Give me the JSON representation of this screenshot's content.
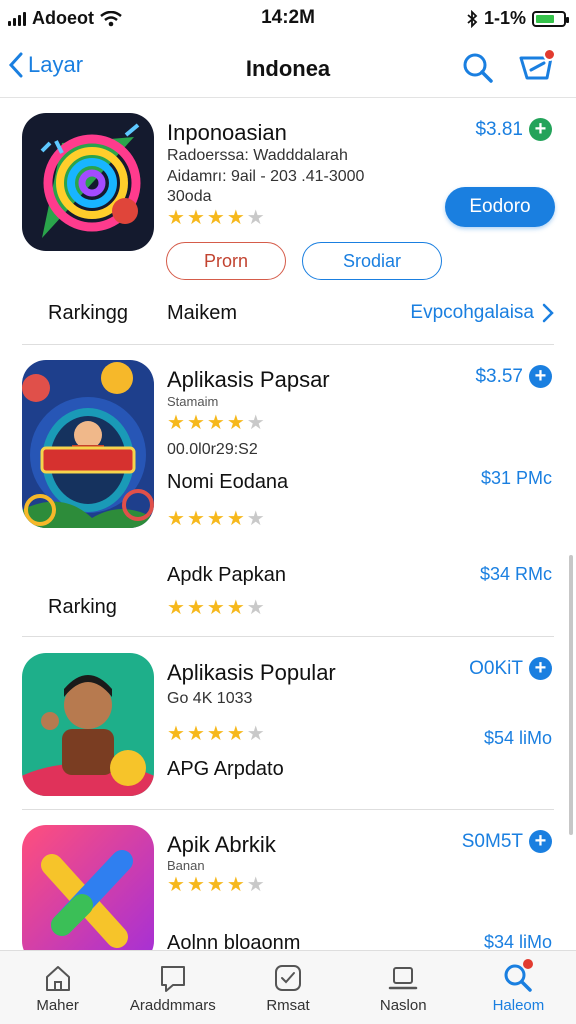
{
  "status_bar": {
    "carrier": "Adoeot",
    "time": "14:2M",
    "battery": "1-1%"
  },
  "nav": {
    "back_label": "Layar",
    "title": "Indonea"
  },
  "apps": [
    {
      "title": "Inponoasian",
      "meta1": "Radoerssa: Wadddalarah",
      "meta2": "Aidamrı: 9ail - 203 .41-3000",
      "meta3": "30oda",
      "price": "$3.81",
      "primary_button": "Eodoro",
      "button_a": "Prorn",
      "button_b": "Srodiar",
      "row_label": "Rarkingg",
      "row_mid": "Maikem",
      "row_link": "Evpcohgalaisa"
    },
    {
      "title": "Aplikasis Papsar",
      "sub": "Stamaim",
      "meta": "00.0l0r29:S2",
      "price": "$3.57",
      "sub_title": "Nomi Eodana",
      "sub_price": "$31 PMc",
      "third_title": "Apdk Papkan",
      "third_price": "$34 RMc",
      "row_label": "Rarking"
    },
    {
      "title": "Aplikasis Popular",
      "meta": "Go 4K 1033",
      "price": "O0KiT",
      "sub_price": "$54 liMo",
      "sub_title": "APG Arpdato"
    },
    {
      "title": "Apik Abrkik",
      "sub": "Banan",
      "price": "S0M5T",
      "sub_title": "Aolnn bloaonm",
      "sub_price": "$34 liMo"
    }
  ],
  "tabs": [
    {
      "label": "Maher",
      "icon": "home-icon"
    },
    {
      "label": "Araddmmars",
      "icon": "book-icon"
    },
    {
      "label": "Rmsat",
      "icon": "check-square-icon"
    },
    {
      "label": "Naslon",
      "icon": "laptop-icon"
    },
    {
      "label": "Haleom",
      "icon": "search-icon"
    }
  ],
  "colors": {
    "accent": "#1a7fe0",
    "star": "#f6b81c",
    "badge": "#e23b2f",
    "price_plus_green": "#23a35a"
  }
}
